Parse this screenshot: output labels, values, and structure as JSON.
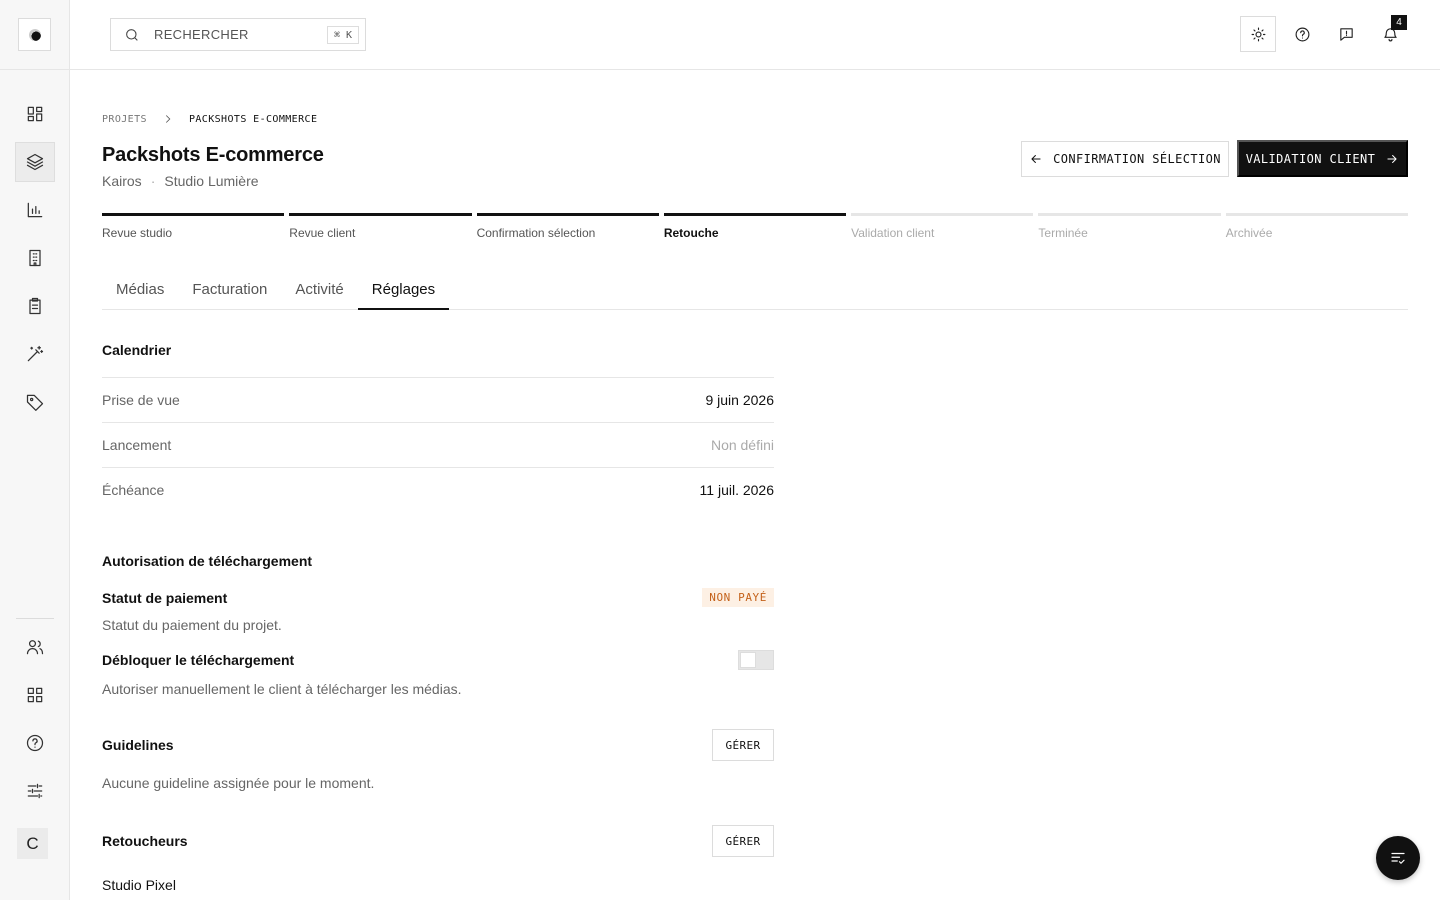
{
  "search": {
    "placeholder": "RECHERCHER",
    "shortcut": "⌘ K"
  },
  "notifications": {
    "count": "4"
  },
  "breadcrumb": {
    "root": "PROJETS",
    "current": "PACKSHOTS E-COMMERCE"
  },
  "project": {
    "title": "Packshots E-commerce",
    "client": "Kairos",
    "studio": "Studio Lumière"
  },
  "actions": {
    "prev_label": "CONFIRMATION SÉLECTION",
    "next_label": "VALIDATION CLIENT"
  },
  "stepper": [
    {
      "label": "Revue studio",
      "state": "done"
    },
    {
      "label": "Revue client",
      "state": "done"
    },
    {
      "label": "Confirmation sélection",
      "state": "done"
    },
    {
      "label": "Retouche",
      "state": "current"
    },
    {
      "label": "Validation client",
      "state": "todo"
    },
    {
      "label": "Terminée",
      "state": "todo"
    },
    {
      "label": "Archivée",
      "state": "todo"
    }
  ],
  "tabs": [
    {
      "label": "Médias"
    },
    {
      "label": "Facturation"
    },
    {
      "label": "Activité"
    },
    {
      "label": "Réglages",
      "active": true
    }
  ],
  "calendar": {
    "title": "Calendrier",
    "rows": [
      {
        "label": "Prise de vue",
        "value": "9 juin 2026"
      },
      {
        "label": "Lancement",
        "value": "Non défini"
      },
      {
        "label": "Échéance",
        "value": "11 juil. 2026"
      }
    ]
  },
  "download": {
    "title": "Autorisation de téléchargement",
    "payment_label": "Statut de paiement",
    "payment_status": "NON PAYÉ",
    "payment_desc": "Statut du paiement du projet.",
    "unlock_label": "Débloquer le téléchargement",
    "unlock_desc": "Autoriser manuellement le client à télécharger les médias.",
    "unlock_enabled": false
  },
  "guidelines": {
    "title": "Guidelines",
    "manage_label": "GÉRER",
    "empty": "Aucune guideline assignée pour le moment."
  },
  "retouchers": {
    "title": "Retoucheurs",
    "manage_label": "GÉRER",
    "items": [
      "Studio Pixel"
    ]
  },
  "user": {
    "initial": "C"
  },
  "colors": {
    "accent": "#111111",
    "status_unpaid": "#c4621b",
    "status_unpaid_bg": "#fdf0e4"
  }
}
